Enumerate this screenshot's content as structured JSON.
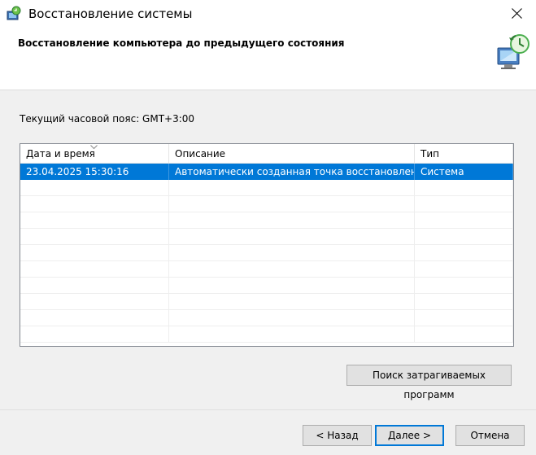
{
  "window": {
    "title": "Восстановление системы",
    "header_title": "Восстановление компьютера до предыдущего состояния"
  },
  "timezone_label": "Текущий часовой пояс: GMT+3:00",
  "table": {
    "columns": [
      "Дата и время",
      "Описание",
      "Тип"
    ],
    "sorted_column": "Дата и время",
    "rows": [
      {
        "date": "23.04.2025 15:30:16",
        "description": "Автоматически созданная точка восстановления",
        "type": "Система",
        "selected": true
      }
    ],
    "empty_rows": 10
  },
  "buttons": {
    "scan": "Поиск затрагиваемых программ",
    "back": "< Назад",
    "next": "Далее >",
    "cancel": "Отмена"
  },
  "icons": {
    "app": "system-restore-icon",
    "header": "system-restore-large-icon",
    "close": "close-icon",
    "sort": "sort-descending-icon"
  },
  "colors": {
    "selection": "#0078d7",
    "default_button_border": "#0078d7",
    "background": "#f0f0f0"
  }
}
